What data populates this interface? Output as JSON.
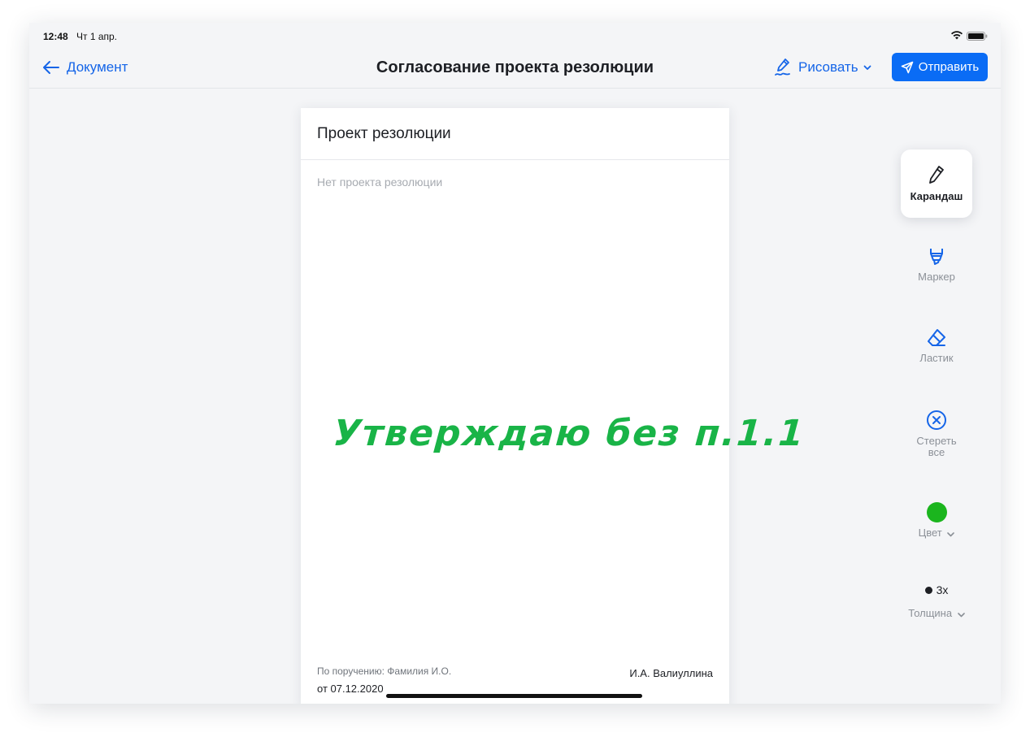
{
  "status": {
    "time": "12:48",
    "date": "Чт 1 апр."
  },
  "nav": {
    "back_label": "Документ",
    "title": "Согласование проекта резолюции",
    "draw_label": "Рисовать",
    "send_label": "Отправить"
  },
  "sheet": {
    "title": "Проект резолюции",
    "placeholder": "Нет проекта резолюции",
    "handwriting": "Утверждаю без п.1.1",
    "assigned_by": "По поручению: Фамилия И.О.",
    "date": "от 07.12.2020",
    "signer": "И.А. Валиуллина"
  },
  "tools": {
    "pencil": "Карандаш",
    "marker": "Маркер",
    "eraser": "Ластик",
    "clear_all_line1": "Стереть",
    "clear_all_line2": "все",
    "color": "Цвет",
    "thickness_value": "3x",
    "thickness": "Толщина"
  },
  "colors": {
    "accent": "#0a6cf5",
    "ink": "#19b447",
    "selected_color": "#1bb51e"
  }
}
